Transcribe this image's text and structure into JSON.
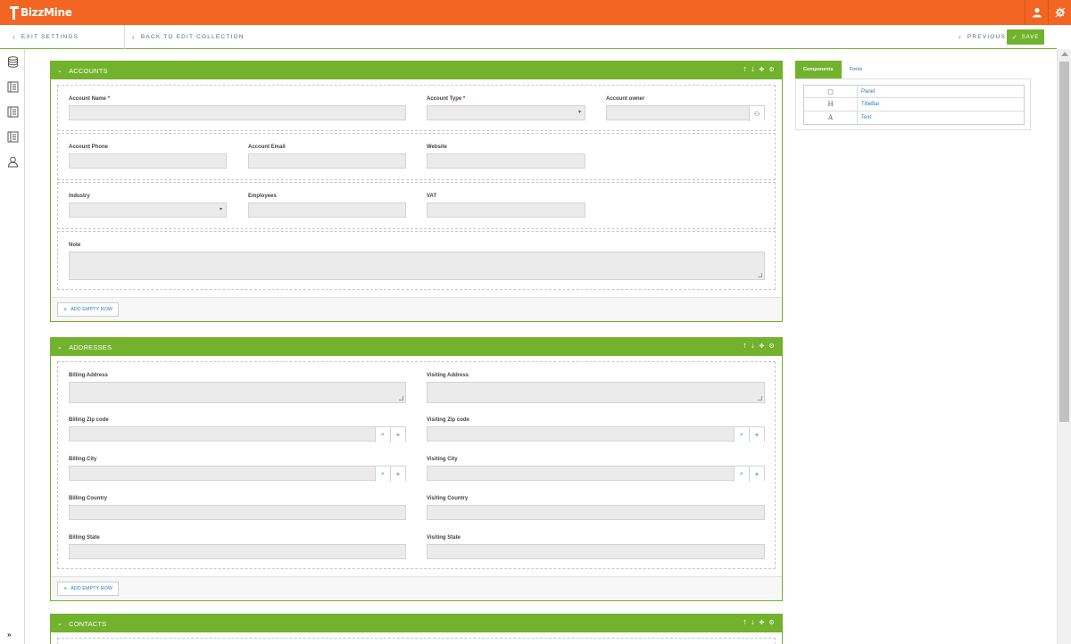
{
  "app": {
    "name": "BizzMine"
  },
  "nav": {
    "exit_settings": "EXIT SETTINGS",
    "back_to_edit": "BACK TO EDIT COLLECTION",
    "previous": "PREVIOUS",
    "save": "SAVE"
  },
  "sidebar": {
    "items": [
      {
        "icon": "database-icon"
      },
      {
        "icon": "list-icon"
      },
      {
        "icon": "list-icon"
      },
      {
        "icon": "list-icon"
      },
      {
        "icon": "user-icon"
      }
    ],
    "expand": "»"
  },
  "accounts": {
    "title": "ACCOUNTS",
    "fields": {
      "account_name": "Account Name",
      "account_type": "Account Type",
      "account_owner": "Account owner",
      "account_phone": "Account Phone",
      "account_email": "Account Email",
      "website": "Website",
      "industry": "Industry",
      "employees": "Employees",
      "vat": "VAT",
      "note": "Note"
    },
    "required_mark": "*",
    "add_row": "ADD EMPTY ROW"
  },
  "addresses": {
    "title": "ADDRESSES",
    "fields": {
      "billing_address": "Billing Address",
      "visiting_address": "Visiting Address",
      "billing_zip": "Billing Zip code",
      "visiting_zip": "Visiting Zip code",
      "billing_city": "Billing City",
      "visiting_city": "Visiting City",
      "billing_country": "Billing Country",
      "visiting_country": "Visiting Country",
      "billing_state": "Billing State",
      "visiting_state": "Visiting State"
    },
    "add_row": "ADD EMPTY ROW"
  },
  "contacts": {
    "title": "CONTACTS"
  },
  "right_panel": {
    "tabs": [
      "Components",
      "Fields"
    ],
    "active_tab": "Components",
    "components": [
      {
        "glyph": "▢",
        "label": "Panel"
      },
      {
        "glyph": "H",
        "label": "TitleBar"
      },
      {
        "glyph": "A",
        "label": "Text"
      }
    ]
  },
  "colors": {
    "brand_orange": "#f26522",
    "accent_green": "#72b22c",
    "link_blue": "#2a7dbf"
  }
}
